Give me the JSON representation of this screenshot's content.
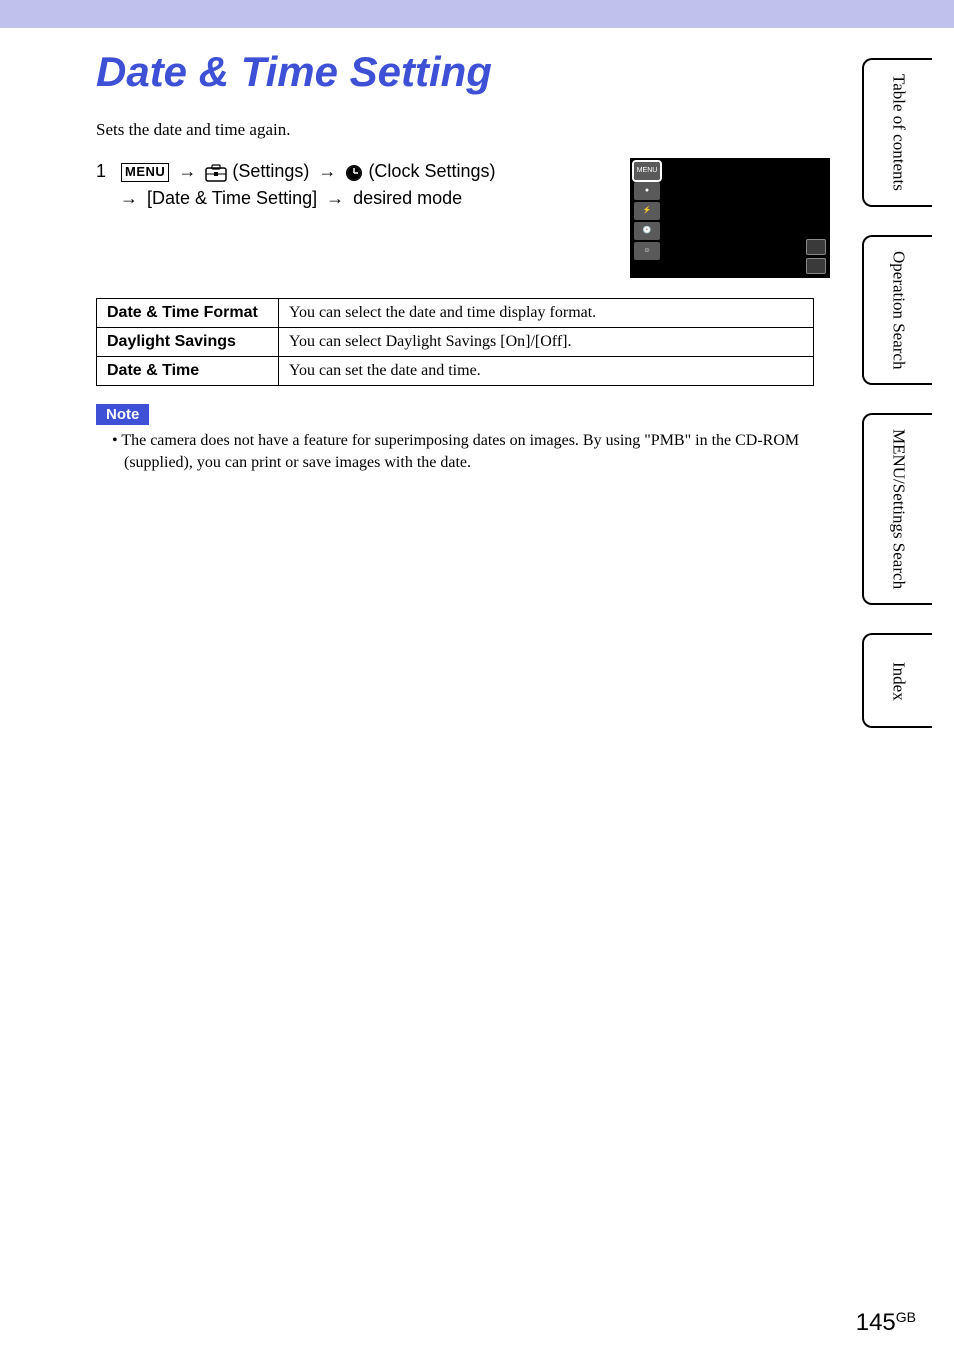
{
  "title": "Date & Time Setting",
  "intro": "Sets the date and time again.",
  "instruction": {
    "step": "1",
    "menu_label": "MENU",
    "settings_label": "(Settings)",
    "clock_label": "(Clock Settings)",
    "path_text": "[Date & Time Setting]",
    "desired": "desired mode",
    "arrow": "t"
  },
  "table": {
    "rows": [
      {
        "label": "Date & Time Format",
        "desc": "You can select the date and time display format."
      },
      {
        "label": "Daylight Savings",
        "desc": "You can select Daylight Savings [On]/[Off]."
      },
      {
        "label": "Date & Time",
        "desc": "You can set the date and time."
      }
    ]
  },
  "note": {
    "heading": "Note",
    "text": "• The camera does not have a feature for superimposing dates on images. By using \"PMB\" in the CD-ROM (supplied), you can print or save images with the date."
  },
  "side_tabs": {
    "toc": "Table of contents",
    "operation": "Operation Search",
    "menu": "MENU/Settings Search",
    "index": "Index"
  },
  "page": {
    "number": "145",
    "suffix": "GB"
  }
}
